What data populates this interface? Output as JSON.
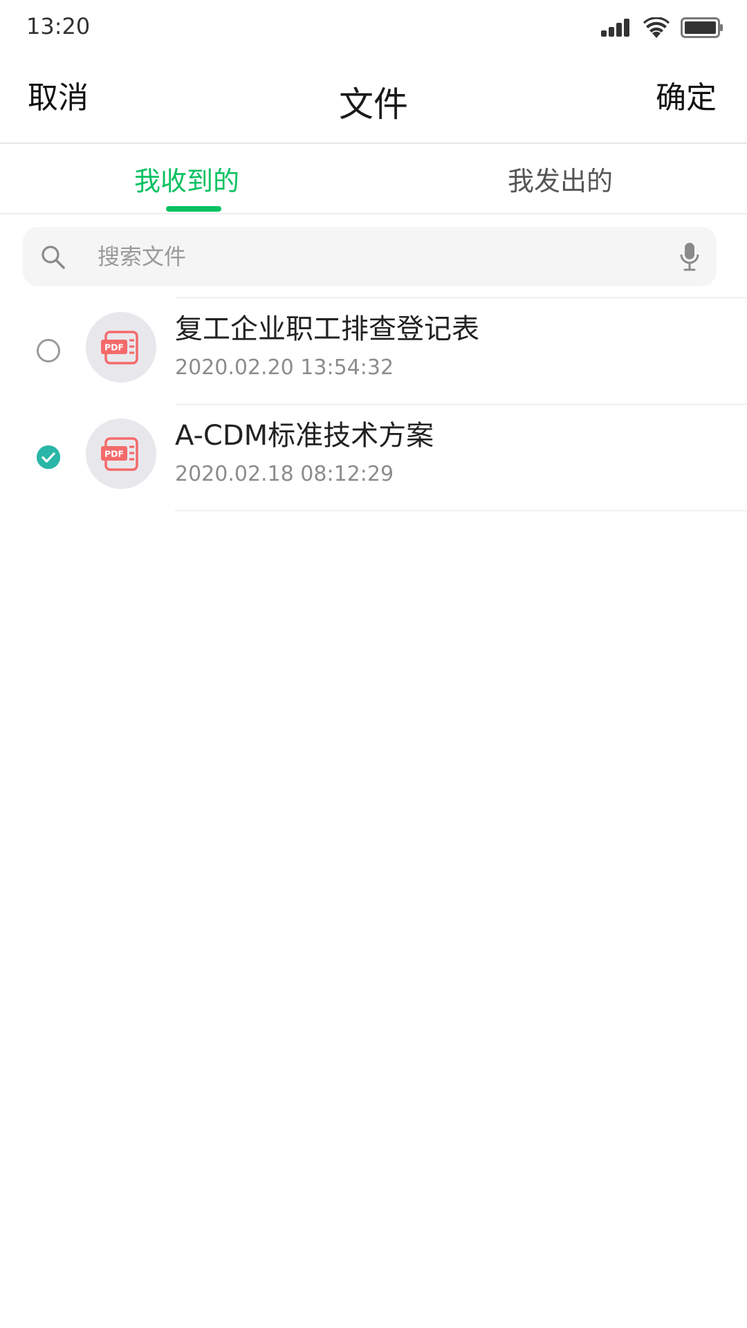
{
  "status_bar": {
    "time": "13:20",
    "icons": [
      "signal-icon",
      "wifi-icon",
      "battery-icon"
    ]
  },
  "header": {
    "cancel_label": "取消",
    "title": "文件",
    "confirm_label": "确定"
  },
  "tabs": [
    {
      "label": "我收到的",
      "active": true
    },
    {
      "label": "我发出的",
      "active": false
    }
  ],
  "search": {
    "placeholder": "搜索文件",
    "value": ""
  },
  "files": [
    {
      "name": "复工企业职工排查登记表",
      "time": "2020.02.20 13:54:32",
      "type_badge": "PDF",
      "selected": false
    },
    {
      "name": "A-CDM标准技术方案",
      "time": "2020.02.18 08:12:29",
      "type_badge": "PDF",
      "selected": true
    }
  ],
  "colors": {
    "accent": "#07c160",
    "checked": "#2bb7a8",
    "pdf": "#f46a6a"
  }
}
